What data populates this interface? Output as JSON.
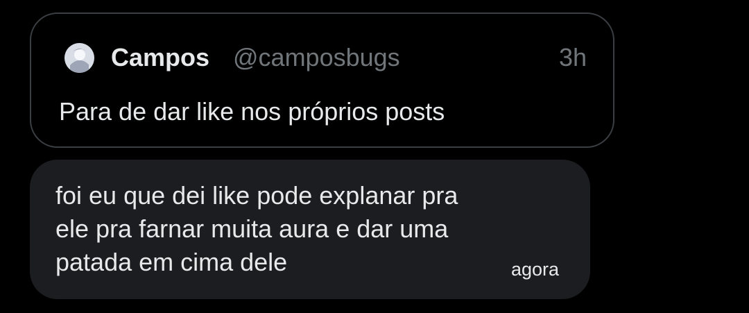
{
  "quoted_post": {
    "author_name": "Campos",
    "author_handle": "@camposbugs",
    "time": "3h",
    "text": "Para de dar like nos próprios posts"
  },
  "message": {
    "lines": [
      "foi eu que dei like pode explanar pra",
      "ele pra farnar muita aura e dar uma",
      "patada em cima dele"
    ],
    "time": "agora"
  }
}
